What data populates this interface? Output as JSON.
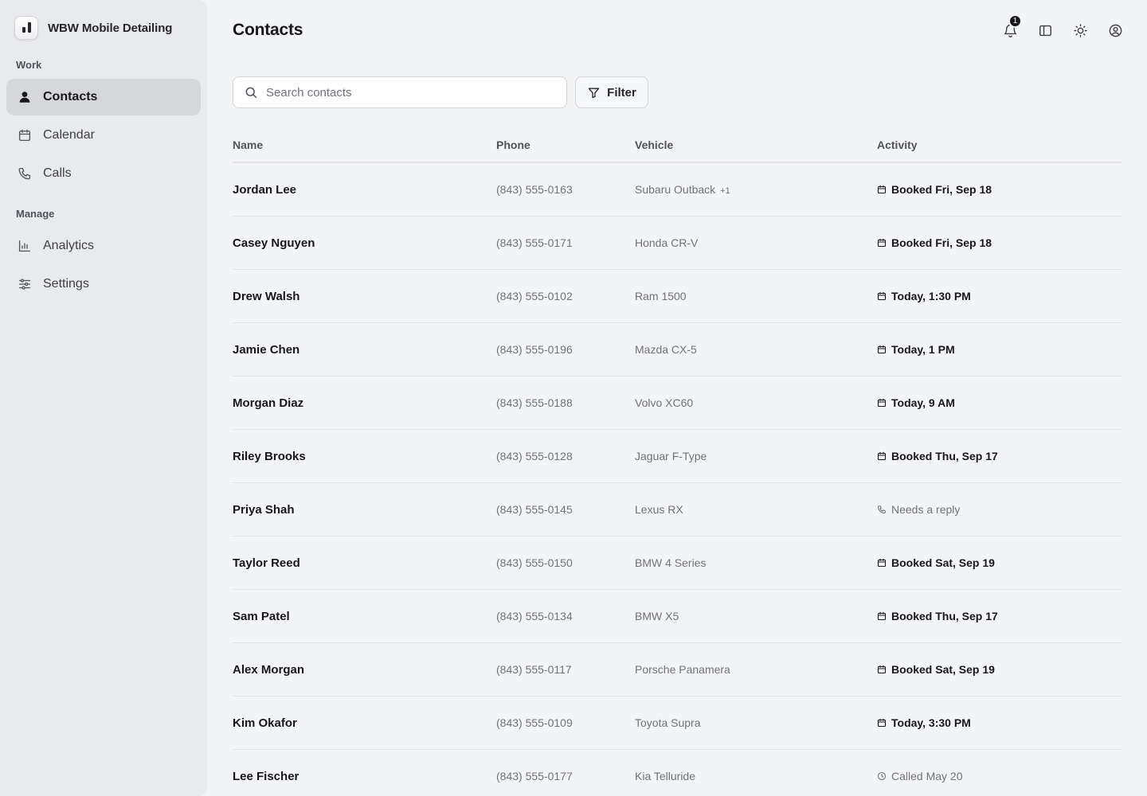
{
  "sidebar": {
    "brand": "WBW Mobile Detailing",
    "sections": [
      {
        "label": "Work",
        "items": [
          {
            "label": "Contacts",
            "icon": "person-icon",
            "active": true
          },
          {
            "label": "Calendar",
            "icon": "calendar-icon",
            "active": false
          },
          {
            "label": "Calls",
            "icon": "phone-icon",
            "active": false
          }
        ]
      },
      {
        "label": "Manage",
        "items": [
          {
            "label": "Analytics",
            "icon": "bar-chart-icon",
            "active": false
          },
          {
            "label": "Settings",
            "icon": "sliders-icon",
            "active": false
          }
        ]
      }
    ]
  },
  "header": {
    "title": "Contacts",
    "notifications_count": "1",
    "icons": [
      "bell-icon",
      "sidebar-toggle-icon",
      "sun-icon",
      "user-circle-icon"
    ]
  },
  "search": {
    "placeholder": "Search contacts",
    "value": ""
  },
  "filter": {
    "label": "Filter"
  },
  "table": {
    "columns": [
      "Name",
      "Phone",
      "Vehicle",
      "Activity"
    ],
    "rows": [
      {
        "name": "Jordan Lee",
        "phone": "(843) 555-0163",
        "vehicle": "Subaru Outback",
        "extra": "+1",
        "activity": "Booked Fri, Sep 18",
        "activity_icon": "calendar-icon"
      },
      {
        "name": "Casey Nguyen",
        "phone": "(843) 555-0171",
        "vehicle": "Honda CR-V",
        "activity": "Booked Fri, Sep 18",
        "activity_icon": "calendar-icon"
      },
      {
        "name": "Drew Walsh",
        "phone": "(843) 555-0102",
        "vehicle": "Ram 1500",
        "activity": "Today, 1:30 PM",
        "activity_icon": "calendar-icon"
      },
      {
        "name": "Jamie Chen",
        "phone": "(843) 555-0196",
        "vehicle": "Mazda CX-5",
        "activity": "Today, 1 PM",
        "activity_icon": "calendar-icon"
      },
      {
        "name": "Morgan Diaz",
        "phone": "(843) 555-0188",
        "vehicle": "Volvo XC60",
        "activity": "Today, 9 AM",
        "activity_icon": "calendar-icon"
      },
      {
        "name": "Riley Brooks",
        "phone": "(843) 555-0128",
        "vehicle": "Jaguar F-Type",
        "activity": "Booked Thu, Sep 17",
        "activity_icon": "calendar-icon"
      },
      {
        "name": "Priya Shah",
        "phone": "(843) 555-0145",
        "vehicle": "Lexus RX",
        "activity": "Needs a reply",
        "activity_icon": "phone-icon"
      },
      {
        "name": "Taylor Reed",
        "phone": "(843) 555-0150",
        "vehicle": "BMW 4 Series",
        "activity": "Booked Sat, Sep 19",
        "activity_icon": "calendar-icon"
      },
      {
        "name": "Sam Patel",
        "phone": "(843) 555-0134",
        "vehicle": "BMW X5",
        "activity": "Booked Thu, Sep 17",
        "activity_icon": "calendar-icon"
      },
      {
        "name": "Alex Morgan",
        "phone": "(843) 555-0117",
        "vehicle": "Porsche Panamera",
        "activity": "Booked Sat, Sep 19",
        "activity_icon": "calendar-icon"
      },
      {
        "name": "Kim Okafor",
        "phone": "(843) 555-0109",
        "vehicle": "Toyota Supra",
        "activity": "Today, 3:30 PM",
        "activity_icon": "calendar-icon"
      },
      {
        "name": "Lee Fischer",
        "phone": "(843) 555-0177",
        "vehicle": "Kia Telluride",
        "activity": "Called May 20",
        "activity_icon": "clock-icon"
      }
    ]
  }
}
